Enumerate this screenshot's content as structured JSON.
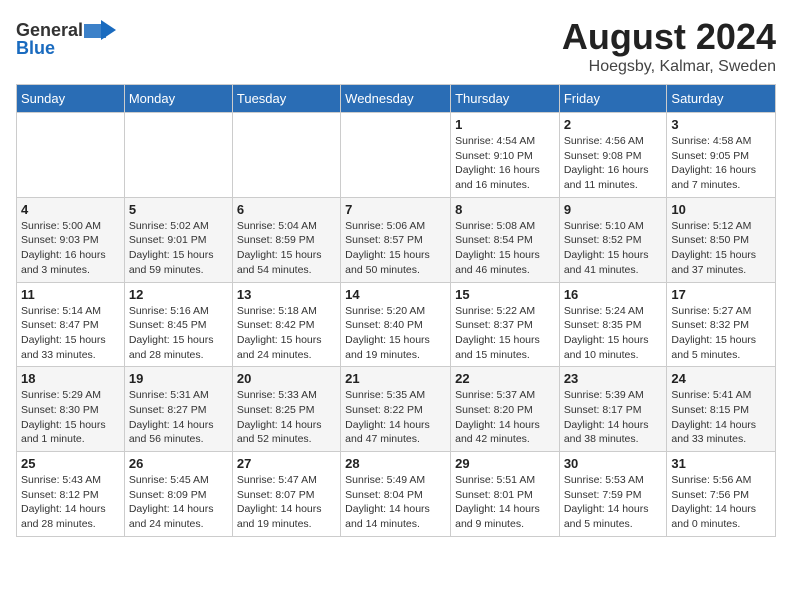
{
  "logo": {
    "line1": "General",
    "line2": "Blue"
  },
  "header": {
    "month": "August 2024",
    "location": "Hoegsby, Kalmar, Sweden"
  },
  "weekdays": [
    "Sunday",
    "Monday",
    "Tuesday",
    "Wednesday",
    "Thursday",
    "Friday",
    "Saturday"
  ],
  "days": [
    {
      "num": "",
      "sunrise": "",
      "sunset": "",
      "daylight": ""
    },
    {
      "num": "",
      "sunrise": "",
      "sunset": "",
      "daylight": ""
    },
    {
      "num": "",
      "sunrise": "",
      "sunset": "",
      "daylight": ""
    },
    {
      "num": "",
      "sunrise": "",
      "sunset": "",
      "daylight": ""
    },
    {
      "num": "1",
      "sunrise": "Sunrise: 4:54 AM",
      "sunset": "Sunset: 9:10 PM",
      "daylight": "Daylight: 16 hours and 16 minutes."
    },
    {
      "num": "2",
      "sunrise": "Sunrise: 4:56 AM",
      "sunset": "Sunset: 9:08 PM",
      "daylight": "Daylight: 16 hours and 11 minutes."
    },
    {
      "num": "3",
      "sunrise": "Sunrise: 4:58 AM",
      "sunset": "Sunset: 9:05 PM",
      "daylight": "Daylight: 16 hours and 7 minutes."
    },
    {
      "num": "4",
      "sunrise": "Sunrise: 5:00 AM",
      "sunset": "Sunset: 9:03 PM",
      "daylight": "Daylight: 16 hours and 3 minutes."
    },
    {
      "num": "5",
      "sunrise": "Sunrise: 5:02 AM",
      "sunset": "Sunset: 9:01 PM",
      "daylight": "Daylight: 15 hours and 59 minutes."
    },
    {
      "num": "6",
      "sunrise": "Sunrise: 5:04 AM",
      "sunset": "Sunset: 8:59 PM",
      "daylight": "Daylight: 15 hours and 54 minutes."
    },
    {
      "num": "7",
      "sunrise": "Sunrise: 5:06 AM",
      "sunset": "Sunset: 8:57 PM",
      "daylight": "Daylight: 15 hours and 50 minutes."
    },
    {
      "num": "8",
      "sunrise": "Sunrise: 5:08 AM",
      "sunset": "Sunset: 8:54 PM",
      "daylight": "Daylight: 15 hours and 46 minutes."
    },
    {
      "num": "9",
      "sunrise": "Sunrise: 5:10 AM",
      "sunset": "Sunset: 8:52 PM",
      "daylight": "Daylight: 15 hours and 41 minutes."
    },
    {
      "num": "10",
      "sunrise": "Sunrise: 5:12 AM",
      "sunset": "Sunset: 8:50 PM",
      "daylight": "Daylight: 15 hours and 37 minutes."
    },
    {
      "num": "11",
      "sunrise": "Sunrise: 5:14 AM",
      "sunset": "Sunset: 8:47 PM",
      "daylight": "Daylight: 15 hours and 33 minutes."
    },
    {
      "num": "12",
      "sunrise": "Sunrise: 5:16 AM",
      "sunset": "Sunset: 8:45 PM",
      "daylight": "Daylight: 15 hours and 28 minutes."
    },
    {
      "num": "13",
      "sunrise": "Sunrise: 5:18 AM",
      "sunset": "Sunset: 8:42 PM",
      "daylight": "Daylight: 15 hours and 24 minutes."
    },
    {
      "num": "14",
      "sunrise": "Sunrise: 5:20 AM",
      "sunset": "Sunset: 8:40 PM",
      "daylight": "Daylight: 15 hours and 19 minutes."
    },
    {
      "num": "15",
      "sunrise": "Sunrise: 5:22 AM",
      "sunset": "Sunset: 8:37 PM",
      "daylight": "Daylight: 15 hours and 15 minutes."
    },
    {
      "num": "16",
      "sunrise": "Sunrise: 5:24 AM",
      "sunset": "Sunset: 8:35 PM",
      "daylight": "Daylight: 15 hours and 10 minutes."
    },
    {
      "num": "17",
      "sunrise": "Sunrise: 5:27 AM",
      "sunset": "Sunset: 8:32 PM",
      "daylight": "Daylight: 15 hours and 5 minutes."
    },
    {
      "num": "18",
      "sunrise": "Sunrise: 5:29 AM",
      "sunset": "Sunset: 8:30 PM",
      "daylight": "Daylight: 15 hours and 1 minute."
    },
    {
      "num": "19",
      "sunrise": "Sunrise: 5:31 AM",
      "sunset": "Sunset: 8:27 PM",
      "daylight": "Daylight: 14 hours and 56 minutes."
    },
    {
      "num": "20",
      "sunrise": "Sunrise: 5:33 AM",
      "sunset": "Sunset: 8:25 PM",
      "daylight": "Daylight: 14 hours and 52 minutes."
    },
    {
      "num": "21",
      "sunrise": "Sunrise: 5:35 AM",
      "sunset": "Sunset: 8:22 PM",
      "daylight": "Daylight: 14 hours and 47 minutes."
    },
    {
      "num": "22",
      "sunrise": "Sunrise: 5:37 AM",
      "sunset": "Sunset: 8:20 PM",
      "daylight": "Daylight: 14 hours and 42 minutes."
    },
    {
      "num": "23",
      "sunrise": "Sunrise: 5:39 AM",
      "sunset": "Sunset: 8:17 PM",
      "daylight": "Daylight: 14 hours and 38 minutes."
    },
    {
      "num": "24",
      "sunrise": "Sunrise: 5:41 AM",
      "sunset": "Sunset: 8:15 PM",
      "daylight": "Daylight: 14 hours and 33 minutes."
    },
    {
      "num": "25",
      "sunrise": "Sunrise: 5:43 AM",
      "sunset": "Sunset: 8:12 PM",
      "daylight": "Daylight: 14 hours and 28 minutes."
    },
    {
      "num": "26",
      "sunrise": "Sunrise: 5:45 AM",
      "sunset": "Sunset: 8:09 PM",
      "daylight": "Daylight: 14 hours and 24 minutes."
    },
    {
      "num": "27",
      "sunrise": "Sunrise: 5:47 AM",
      "sunset": "Sunset: 8:07 PM",
      "daylight": "Daylight: 14 hours and 19 minutes."
    },
    {
      "num": "28",
      "sunrise": "Sunrise: 5:49 AM",
      "sunset": "Sunset: 8:04 PM",
      "daylight": "Daylight: 14 hours and 14 minutes."
    },
    {
      "num": "29",
      "sunrise": "Sunrise: 5:51 AM",
      "sunset": "Sunset: 8:01 PM",
      "daylight": "Daylight: 14 hours and 9 minutes."
    },
    {
      "num": "30",
      "sunrise": "Sunrise: 5:53 AM",
      "sunset": "Sunset: 7:59 PM",
      "daylight": "Daylight: 14 hours and 5 minutes."
    },
    {
      "num": "31",
      "sunrise": "Sunrise: 5:56 AM",
      "sunset": "Sunset: 7:56 PM",
      "daylight": "Daylight: 14 hours and 0 minutes."
    }
  ]
}
